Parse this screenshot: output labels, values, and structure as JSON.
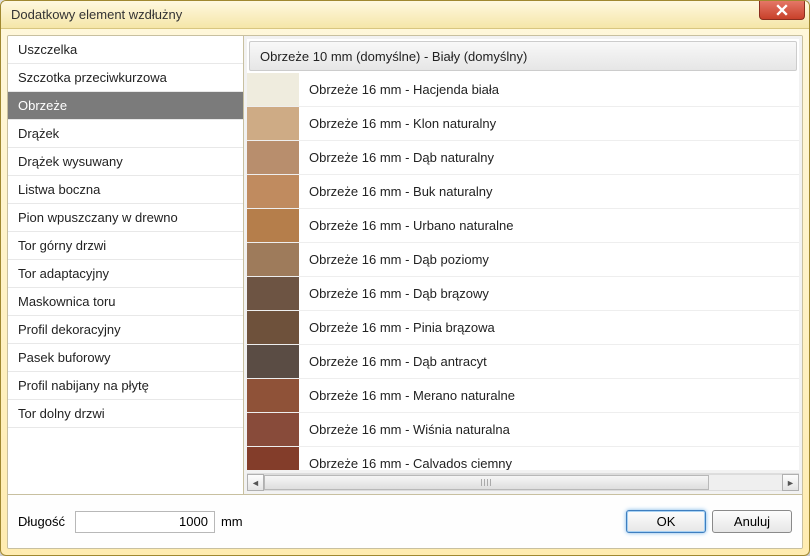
{
  "window": {
    "title": "Dodatkowy element wzdłużny"
  },
  "categories": {
    "items": [
      {
        "label": "Uszczelka"
      },
      {
        "label": "Szczotka przeciwkurzowa"
      },
      {
        "label": "Obrzeże",
        "selected": true
      },
      {
        "label": "Drążek"
      },
      {
        "label": "Drążek wysuwany"
      },
      {
        "label": "Listwa boczna"
      },
      {
        "label": "Pion wpuszczany w drewno"
      },
      {
        "label": "Tor górny drzwi"
      },
      {
        "label": "Tor adaptacyjny"
      },
      {
        "label": "Maskownica toru"
      },
      {
        "label": "Profil dekoracyjny"
      },
      {
        "label": "Pasek buforowy"
      },
      {
        "label": "Profil nabijany na płytę"
      },
      {
        "label": "Tor dolny drzwi"
      }
    ]
  },
  "options": {
    "items": [
      {
        "label": "Obrzeże 10 mm (domyślne) - Biały (domyślny)",
        "color": "",
        "header": true
      },
      {
        "label": "Obrzeże 16 mm - Hacjenda biała",
        "color": "#efecde"
      },
      {
        "label": "Obrzeże 16 mm - Klon naturalny",
        "color": "#ceab85"
      },
      {
        "label": "Obrzeże 16 mm - Dąb naturalny",
        "color": "#b88e6d"
      },
      {
        "label": "Obrzeże 16 mm - Buk naturalny",
        "color": "#c08b5f"
      },
      {
        "label": "Obrzeże 16 mm - Urbano naturalne",
        "color": "#b57e4b"
      },
      {
        "label": "Obrzeże 16 mm - Dąb poziomy",
        "color": "#9e7b5b"
      },
      {
        "label": "Obrzeże 16 mm - Dąb brązowy",
        "color": "#6d5443"
      },
      {
        "label": "Obrzeże 16 mm - Pinia brązowa",
        "color": "#6e513b"
      },
      {
        "label": "Obrzeże 16 mm - Dąb antracyt",
        "color": "#5a4c44"
      },
      {
        "label": "Obrzeże 16 mm - Merano naturalne",
        "color": "#8f5238"
      },
      {
        "label": "Obrzeże 16 mm - Wiśnia naturalna",
        "color": "#884b3a"
      },
      {
        "label": "Obrzeże 16 mm - Calvados ciemny",
        "color": "#833d2a"
      }
    ]
  },
  "footer": {
    "length_label": "Długość",
    "length_value": "1000",
    "length_unit": "mm",
    "ok_label": "OK",
    "cancel_label": "Anuluj"
  }
}
